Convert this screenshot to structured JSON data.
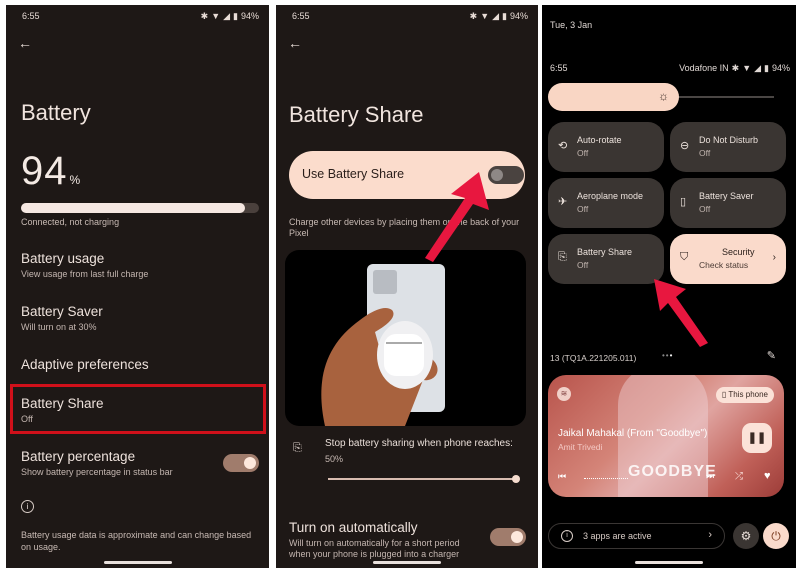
{
  "status_bar": {
    "time": "6:55",
    "battery": "94%",
    "carrier": "Vodafone IN"
  },
  "screen1": {
    "title": "Battery",
    "percent_value": "94",
    "percent_unit": "%",
    "battery_level_fraction": 0.94,
    "charge_status": "Connected, not charging",
    "items": [
      {
        "title": "Battery usage",
        "desc": "View usage from last full charge"
      },
      {
        "title": "Battery Saver",
        "desc": "Will turn on at 30%"
      },
      {
        "title": "Adaptive preferences",
        "desc": ""
      },
      {
        "title": "Battery Share",
        "desc": "Off"
      },
      {
        "title": "Battery percentage",
        "desc": "Show battery percentage in status bar",
        "toggle": true
      }
    ],
    "footer_note": "Battery usage data is approximate and can change based on usage."
  },
  "screen2": {
    "title": "Battery Share",
    "main_toggle_label": "Use Battery Share",
    "main_toggle_on": false,
    "description": "Charge other devices by placing them on the back of your Pixel",
    "stop_label": "Stop battery sharing when phone reaches:",
    "stop_value": "50%",
    "auto_title": "Turn on automatically",
    "auto_desc": "Will turn on automatically for a short period when your phone is plugged into a charger",
    "auto_on": true
  },
  "screen3": {
    "date": "Tue, 3 Jan",
    "brightness_fraction": 0.55,
    "tiles": [
      {
        "label": "Auto-rotate",
        "state": "Off",
        "icon": "rotate-icon"
      },
      {
        "label": "Do Not Disturb",
        "state": "Off",
        "icon": "dnd-icon"
      },
      {
        "label": "Aeroplane mode",
        "state": "Off",
        "icon": "airplane-icon"
      },
      {
        "label": "Battery Saver",
        "state": "Off",
        "icon": "battery-saver-icon"
      },
      {
        "label": "Battery Share",
        "state": "Off",
        "icon": "battery-share-icon"
      },
      {
        "label": "Security",
        "state": "Check status",
        "icon": "shield-icon",
        "active": true
      }
    ],
    "build": "13 (TQ1A.221205.011)",
    "media": {
      "output": "This phone",
      "title": "Jaikal Mahakal (From \"Goodbye\")",
      "artist": "Amit Trivedi",
      "art_text": "GOODBYE"
    },
    "active_apps": "3 apps are active"
  },
  "accent_colors": {
    "highlight_box": "#d0101a",
    "arrow": "#e8173f",
    "accent_peach": "#fbdccc"
  }
}
